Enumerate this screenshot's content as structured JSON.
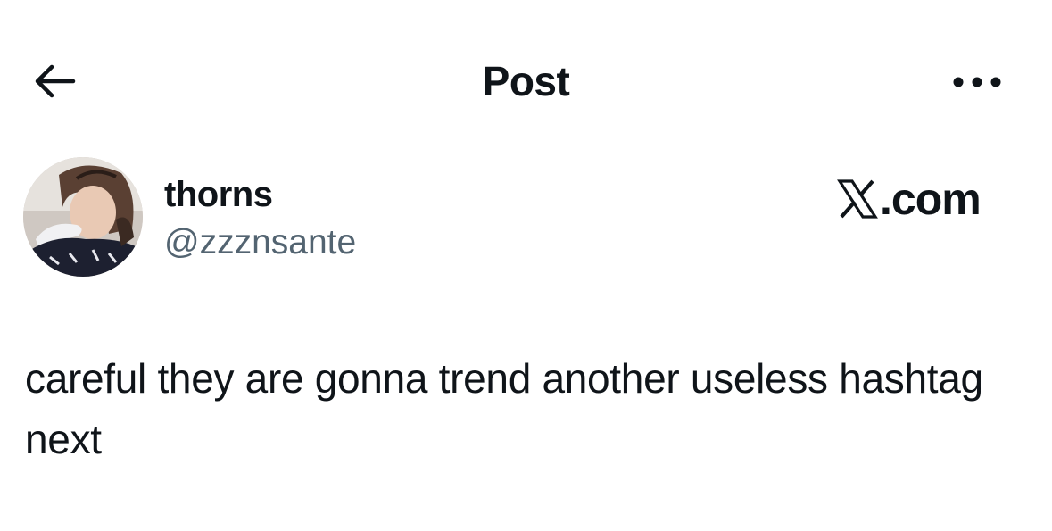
{
  "header": {
    "title": "Post",
    "back_icon": "arrow-left-icon",
    "more_icon": "more-horizontal-icon"
  },
  "author": {
    "display_name": "thorns",
    "handle": "@zzznsante",
    "avatar_icon": "avatar"
  },
  "brand": {
    "icon": "x-logo-icon",
    "text": ".com"
  },
  "post": {
    "text": "careful they are gonna trend another useless hashtag next"
  },
  "colors": {
    "primary_text": "#0f1419",
    "secondary_text": "#536471",
    "background": "#ffffff"
  }
}
